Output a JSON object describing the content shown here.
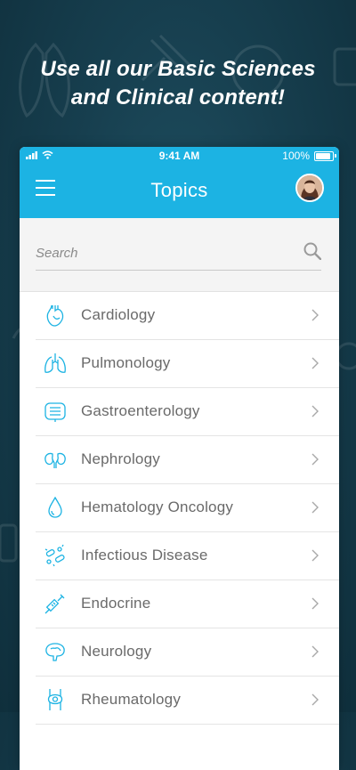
{
  "headline": {
    "line1": "Use all our Basic Sciences",
    "line2": "and Clinical content!"
  },
  "status_bar": {
    "time": "9:41 AM",
    "battery": "100%"
  },
  "nav": {
    "title": "Topics",
    "menu_icon": "hamburger-menu-icon",
    "avatar": "user-avatar"
  },
  "search": {
    "placeholder": "Search",
    "icon": "search-icon"
  },
  "topics": [
    {
      "label": "Cardiology",
      "icon": "heart-icon"
    },
    {
      "label": "Pulmonology",
      "icon": "lungs-icon"
    },
    {
      "label": "Gastroenterology",
      "icon": "intestines-icon"
    },
    {
      "label": "Nephrology",
      "icon": "kidneys-icon"
    },
    {
      "label": "Hematology Oncology",
      "icon": "blood-drop-icon"
    },
    {
      "label": "Infectious Disease",
      "icon": "bacteria-icon"
    },
    {
      "label": "Endocrine",
      "icon": "syringe-icon"
    },
    {
      "label": "Neurology",
      "icon": "brain-icon"
    },
    {
      "label": "Rheumatology",
      "icon": "joint-icon"
    }
  ],
  "colors": {
    "accent": "#1cb3e3",
    "icon_stroke": "#1cb3e3",
    "background": "#173f4f"
  }
}
